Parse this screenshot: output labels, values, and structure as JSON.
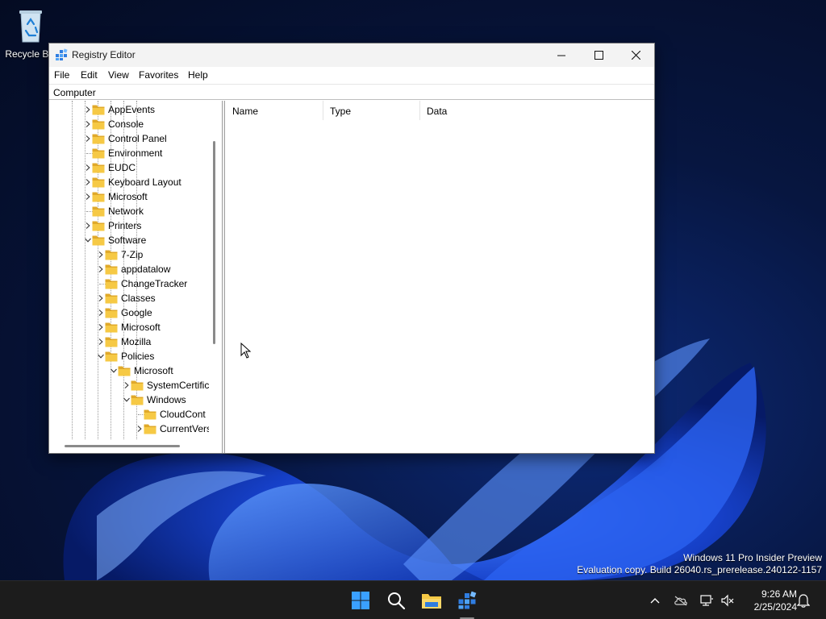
{
  "desktop": {
    "recycle_bin_label": "Recycle Bin",
    "watermark_line1": "Windows 11 Pro Insider Preview",
    "watermark_line2": "Evaluation copy. Build 26040.rs_prerelease.240122-1157"
  },
  "window": {
    "title": "Registry Editor",
    "icon": "registry-icon",
    "controls": [
      "minimize",
      "maximize",
      "close"
    ]
  },
  "menu": {
    "file": "File",
    "edit": "Edit",
    "view": "View",
    "favorites": "Favorites",
    "help": "Help"
  },
  "address": "Computer",
  "tree": {
    "nodes": [
      {
        "label": "AppEvents",
        "depth": 0,
        "expander": "collapsed"
      },
      {
        "label": "Console",
        "depth": 0,
        "expander": "collapsed"
      },
      {
        "label": "Control Panel",
        "depth": 0,
        "expander": "collapsed"
      },
      {
        "label": "Environment",
        "depth": 0,
        "expander": "none"
      },
      {
        "label": "EUDC",
        "depth": 0,
        "expander": "collapsed"
      },
      {
        "label": "Keyboard Layout",
        "depth": 0,
        "expander": "collapsed"
      },
      {
        "label": "Microsoft",
        "depth": 0,
        "expander": "collapsed"
      },
      {
        "label": "Network",
        "depth": 0,
        "expander": "none"
      },
      {
        "label": "Printers",
        "depth": 0,
        "expander": "collapsed"
      },
      {
        "label": "Software",
        "depth": 0,
        "expander": "expanded"
      },
      {
        "label": "7-Zip",
        "depth": 1,
        "expander": "collapsed"
      },
      {
        "label": "appdatalow",
        "depth": 1,
        "expander": "collapsed"
      },
      {
        "label": "ChangeTracker",
        "depth": 1,
        "expander": "none"
      },
      {
        "label": "Classes",
        "depth": 1,
        "expander": "collapsed"
      },
      {
        "label": "Google",
        "depth": 1,
        "expander": "collapsed"
      },
      {
        "label": "Microsoft",
        "depth": 1,
        "expander": "collapsed"
      },
      {
        "label": "Mozilla",
        "depth": 1,
        "expander": "collapsed"
      },
      {
        "label": "Policies",
        "depth": 1,
        "expander": "expanded"
      },
      {
        "label": "Microsoft",
        "depth": 2,
        "expander": "expanded"
      },
      {
        "label": "SystemCertific",
        "depth": 3,
        "expander": "collapsed"
      },
      {
        "label": "Windows",
        "depth": 3,
        "expander": "expanded"
      },
      {
        "label": "CloudCont",
        "depth": 4,
        "expander": "none"
      },
      {
        "label": "CurrentVers",
        "depth": 4,
        "expander": "collapsed"
      }
    ]
  },
  "list": {
    "columns": [
      "Name",
      "Type",
      "Data"
    ]
  },
  "taskbar": {
    "items": [
      "start-icon",
      "search-icon",
      "file-explorer-icon",
      "registry-editor-icon"
    ],
    "tray": [
      "chevron-up-icon",
      "cloud-offline-icon",
      "network-icon",
      "volume-muted-icon",
      "notification-bell-icon"
    ],
    "time": "9:26 AM",
    "date": "2/25/2024"
  },
  "colors": {
    "folder": "#f6c945",
    "folder_dark": "#e0a92a",
    "taskbar": "#1c1c1c",
    "wallpaper_accent": "#1d4fe0"
  }
}
